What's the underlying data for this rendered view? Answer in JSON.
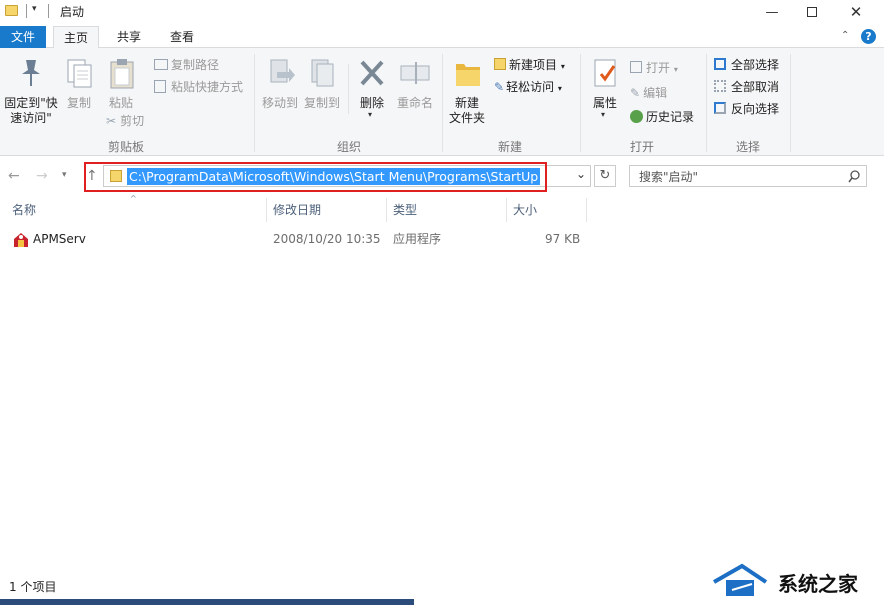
{
  "window": {
    "title": "启动"
  },
  "tabs": {
    "file": "文件",
    "home": "主页",
    "share": "共享",
    "view": "查看"
  },
  "ribbon": {
    "clipboard": {
      "pin": "固定到\"快速访问\"",
      "copy": "复制",
      "paste": "粘贴",
      "copy_path": "复制路径",
      "paste_shortcut": "粘贴快捷方式",
      "cut": "剪切",
      "group": "剪贴板"
    },
    "organize": {
      "move_to": "移动到",
      "copy_to": "复制到",
      "delete": "删除",
      "rename": "重命名",
      "group": "组织"
    },
    "new": {
      "new_item": "新建项目",
      "easy_access": "轻松访问",
      "new_folder": "新建\n文件夹",
      "group": "新建"
    },
    "open": {
      "properties": "属性",
      "open": "打开",
      "edit": "编辑",
      "history": "历史记录",
      "group": "打开"
    },
    "select": {
      "select_all": "全部选择",
      "select_none": "全部取消",
      "invert": "反向选择",
      "group": "选择"
    }
  },
  "address": {
    "path": "C:\\ProgramData\\Microsoft\\Windows\\Start Menu\\Programs\\StartUp",
    "search_placeholder": "搜索\"启动\""
  },
  "columns": {
    "name": "名称",
    "modified": "修改日期",
    "type": "类型",
    "size": "大小"
  },
  "files": [
    {
      "name": "APMServ",
      "modified": "2008/10/20 10:35",
      "type": "应用程序",
      "size": "97 KB"
    }
  ],
  "status": {
    "count": "1 个项目"
  },
  "watermark": {
    "text": "系统之家"
  },
  "colors": {
    "accent": "#1979ca",
    "highlight": "#e02020",
    "selection": "#3399ff"
  }
}
